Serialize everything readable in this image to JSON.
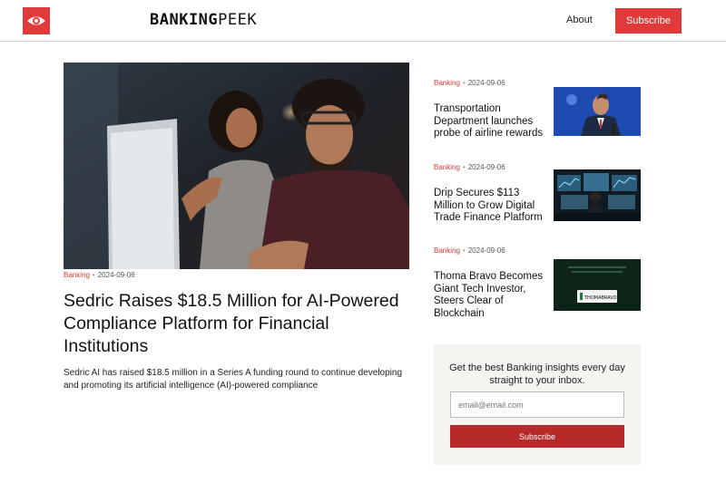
{
  "header": {
    "logo_icon": "eye-icon",
    "brand_bold": "BANKING",
    "brand_light": "PEEK",
    "nav_about": "About",
    "subscribe": "Subscribe",
    "accent": "#e03a3a"
  },
  "featured": {
    "image_icon": "office-people-photo",
    "category": "Banking",
    "date": "2024-09-06",
    "title": "Sedric Raises $18.5 Million for AI-Powered Compliance Platform for Financial Institutions",
    "description": "Sedric AI has raised $18.5 million in a Series A funding round to continue developing and promoting its artificial intelligence (AI)-powered compliance"
  },
  "side": [
    {
      "category": "Banking",
      "date": "2024-09-06",
      "title": "Transportation Department launches probe of airline rewards",
      "thumb_icon": "speaker-photo"
    },
    {
      "category": "Banking",
      "date": "2024-09-06",
      "title": "Drip Secures $113 Million to Grow Digital Trade Finance Platform",
      "thumb_icon": "trading-screens-photo"
    },
    {
      "category": "Banking",
      "date": "2024-09-06",
      "title": "Thoma Bravo Becomes Giant Tech Investor, Steers Clear of Blockchain",
      "thumb_icon": "thomabravo-logo-photo",
      "thumb_logo_text": "THOMABRAVO"
    }
  ],
  "newsletter": {
    "text": "Get the best Banking insights every day straight to your inbox.",
    "email_placeholder": "email@email.com",
    "subscribe": "Subscribe",
    "button_color": "#b82a2a"
  }
}
